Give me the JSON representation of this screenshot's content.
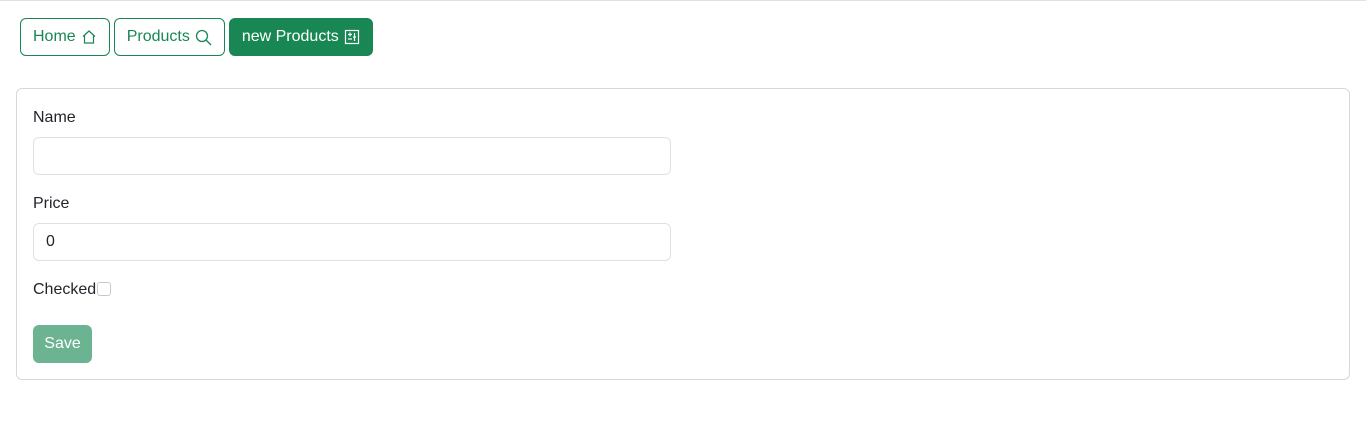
{
  "nav": {
    "home_label": "Home",
    "products_label": "Products",
    "new_products_label": "new Products",
    "home_icon": "house-icon",
    "products_icon": "search-icon",
    "new_products_icon": "add-box-icon"
  },
  "form": {
    "name_label": "Name",
    "name_value": "",
    "price_label": "Price",
    "price_value": "0",
    "checked_label": "Checked",
    "checked_value": false,
    "save_label": "Save"
  },
  "colors": {
    "accent": "#198754",
    "save_disabled": "#6cb391",
    "border": "#dee2e6"
  }
}
